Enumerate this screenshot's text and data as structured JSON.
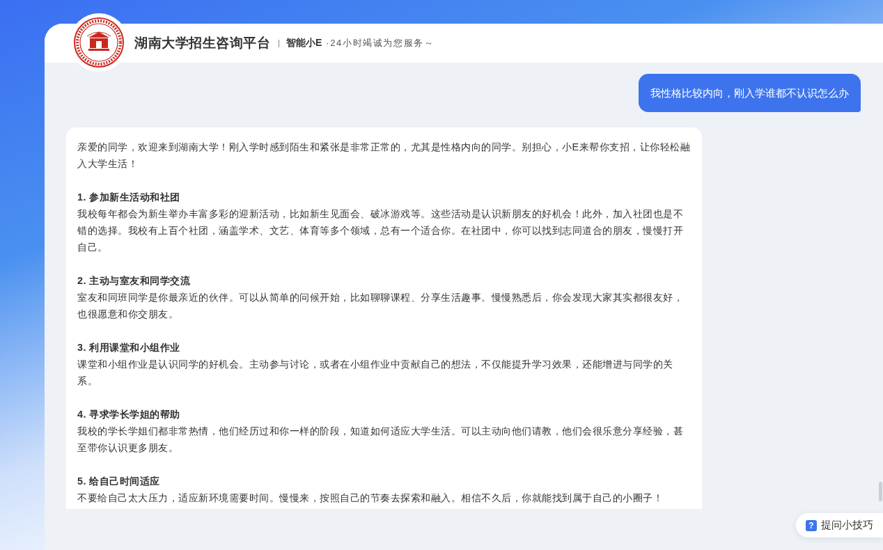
{
  "header": {
    "title": "湖南大学招生咨询平台",
    "assistant_name": "智能小E",
    "tagline": "·24小时竭诚为您服务～"
  },
  "messages": [
    {
      "kind": "user",
      "text": "我性格比较内向，刚入学谁都不认识怎么办"
    },
    {
      "kind": "assistant",
      "intro": "亲爱的同学，欢迎来到湖南大学！刚入学时感到陌生和紧张是非常正常的，尤其是性格内向的同学。别担心，小E来帮你支招，让你轻松融入大学生活！",
      "sections": [
        {
          "heading": "1. 参加新生活动和社团",
          "body": "我校每年都会为新生举办丰富多彩的迎新活动，比如新生见面会、破冰游戏等。这些活动是认识新朋友的好机会！此外，加入社团也是不错的选择。我校有上百个社团，涵盖学术、文艺、体育等多个领域，总有一个适合你。在社团中，你可以找到志同道合的朋友，慢慢打开自己。"
        },
        {
          "heading": "2. 主动与室友和同学交流",
          "body": "室友和同班同学是你最亲近的伙伴。可以从简单的问候开始，比如聊聊课程、分享生活趣事。慢慢熟悉后，你会发现大家其实都很友好，也很愿意和你交朋友。"
        },
        {
          "heading": "3. 利用课堂和小组作业",
          "body": "课堂和小组作业是认识同学的好机会。主动参与讨论，或者在小组作业中贡献自己的想法，不仅能提升学习效果，还能增进与同学的关系。"
        },
        {
          "heading": "4. 寻求学长学姐的帮助",
          "body": "我校的学长学姐们都非常热情，他们经历过和你一样的阶段，知道如何适应大学生活。可以主动向他们请教，他们会很乐意分享经验，甚至带你认识更多朋友。"
        },
        {
          "heading": "5. 给自己时间适应",
          "body": "不要给自己太大压力，适应新环境需要时间。慢慢来，按照自己的节奏去探索和融入。相信不久后，你就能找到属于自己的小圈子！"
        }
      ]
    }
  ],
  "tips_button": {
    "icon_glyph": "?",
    "label": "提问小技巧"
  }
}
